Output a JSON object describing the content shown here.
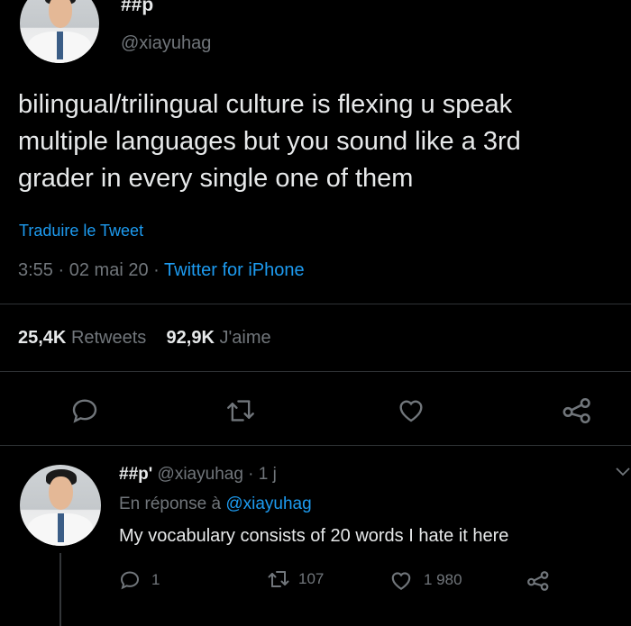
{
  "tweet": {
    "display_name": "##p",
    "handle": "@xiayuhag",
    "text_lines": [
      "bilingual/trilingual culture is flexing u speak",
      "multiple languages but you sound like a 3rd",
      "grader in every single one of them"
    ],
    "translate_label": "Traduire le Tweet",
    "time": "3:55",
    "sep": "·",
    "date": "02 mai 20",
    "source": "Twitter for iPhone",
    "retweets_count": "25,4K",
    "retweets_label": "Retweets",
    "likes_count": "92,9K",
    "likes_label": "J'aime"
  },
  "reply": {
    "display_name": "##p'",
    "handle_time": "@xiayuhag · 1 j",
    "in_reply_prefix": "En réponse à",
    "in_reply_handle": "@xiayuhag",
    "text": "My vocabulary consists of 20 words I hate it here",
    "replies": "1",
    "retweets": "107",
    "likes": "1 980"
  },
  "icons": {
    "reply": "reply-icon",
    "retweet": "retweet-icon",
    "like": "heart-icon",
    "share": "share-icon",
    "more": "chevron-down-icon"
  },
  "colors": {
    "background": "#000000",
    "text": "#e7e9ea",
    "muted": "#71767b",
    "link": "#1d9bf0",
    "divider": "#2f3336"
  }
}
